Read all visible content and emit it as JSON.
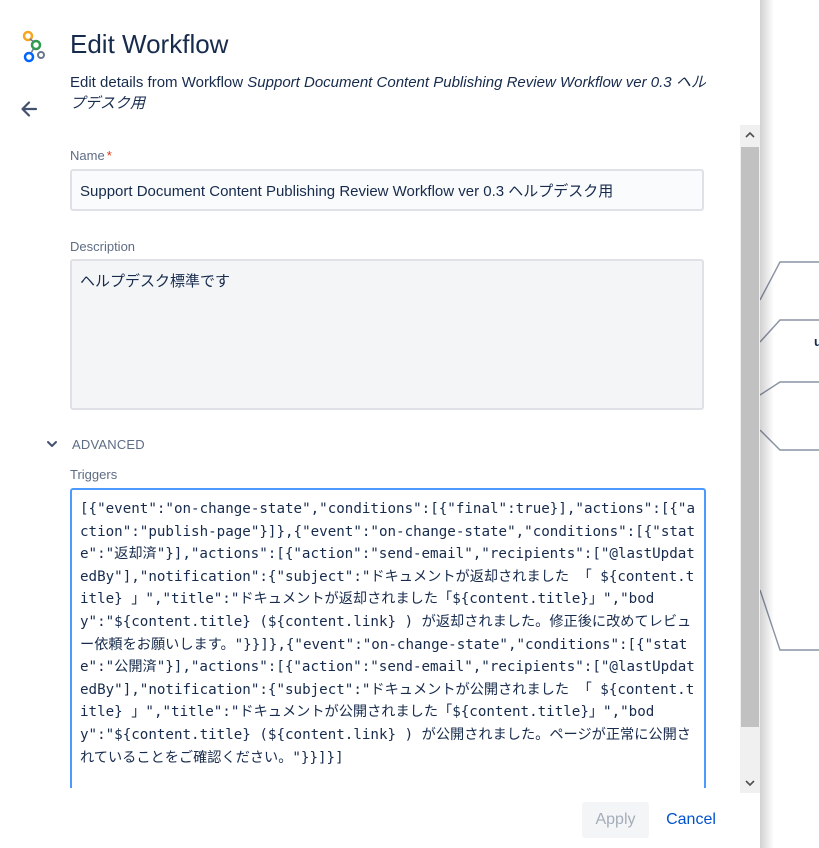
{
  "header": {
    "title": "Edit Workflow",
    "subtitle_prefix": "Edit details from Workflow ",
    "workflow_name": "Support Document Content Publishing Review Workflow ver 0.3 ヘルプデスク用",
    "back_icon": "arrow-left-icon",
    "logo_icon": "workflow-logo-icon"
  },
  "form": {
    "name_label": "Name",
    "name_required": "*",
    "name_value": "Support Document Content Publishing Review Workflow ver 0.3 ヘルプデスク用",
    "description_label": "Description",
    "description_value": "ヘルプデスク標準です",
    "advanced_label": "ADVANCED",
    "triggers_label": "Triggers",
    "triggers_value": "[{\"event\":\"on-change-state\",\"conditions\":[{\"final\":true}],\"actions\":[{\"action\":\"publish-page\"}]},{\"event\":\"on-change-state\",\"conditions\":[{\"state\":\"返却済\"}],\"actions\":[{\"action\":\"send-email\",\"recipients\":[\"@lastUpdatedBy\"],\"notification\":{\"subject\":\"ドキュメントが返却されました 「 ${content.title} 」\",\"title\":\"ドキュメントが返却されました「${content.title}」\",\"body\":\"${content.title} (${content.link} ) が返却されました。修正後に改めてレビュー依頼をお願いします。\"}}]},{\"event\":\"on-change-state\",\"conditions\":[{\"state\":\"公開済\"}],\"actions\":[{\"action\":\"send-email\",\"recipients\":[\"@lastUpdatedBy\"],\"notification\":{\"subject\":\"ドキュメントが公開されました 「 ${content.title} 」\",\"title\":\"ドキュメントが公開されました「${content.title}」\",\"body\":\"${content.title} (${content.link} ) が公開されました。ページが正常に公開されていることをご確認ください。\"}}]}]"
  },
  "footer": {
    "apply_label": "Apply",
    "cancel_label": "Cancel"
  },
  "background": {
    "glyph": "u"
  },
  "colors": {
    "accent": "#0052cc",
    "focus_border": "#4c9aff",
    "required": "#de350b",
    "label": "#5e6c84"
  }
}
